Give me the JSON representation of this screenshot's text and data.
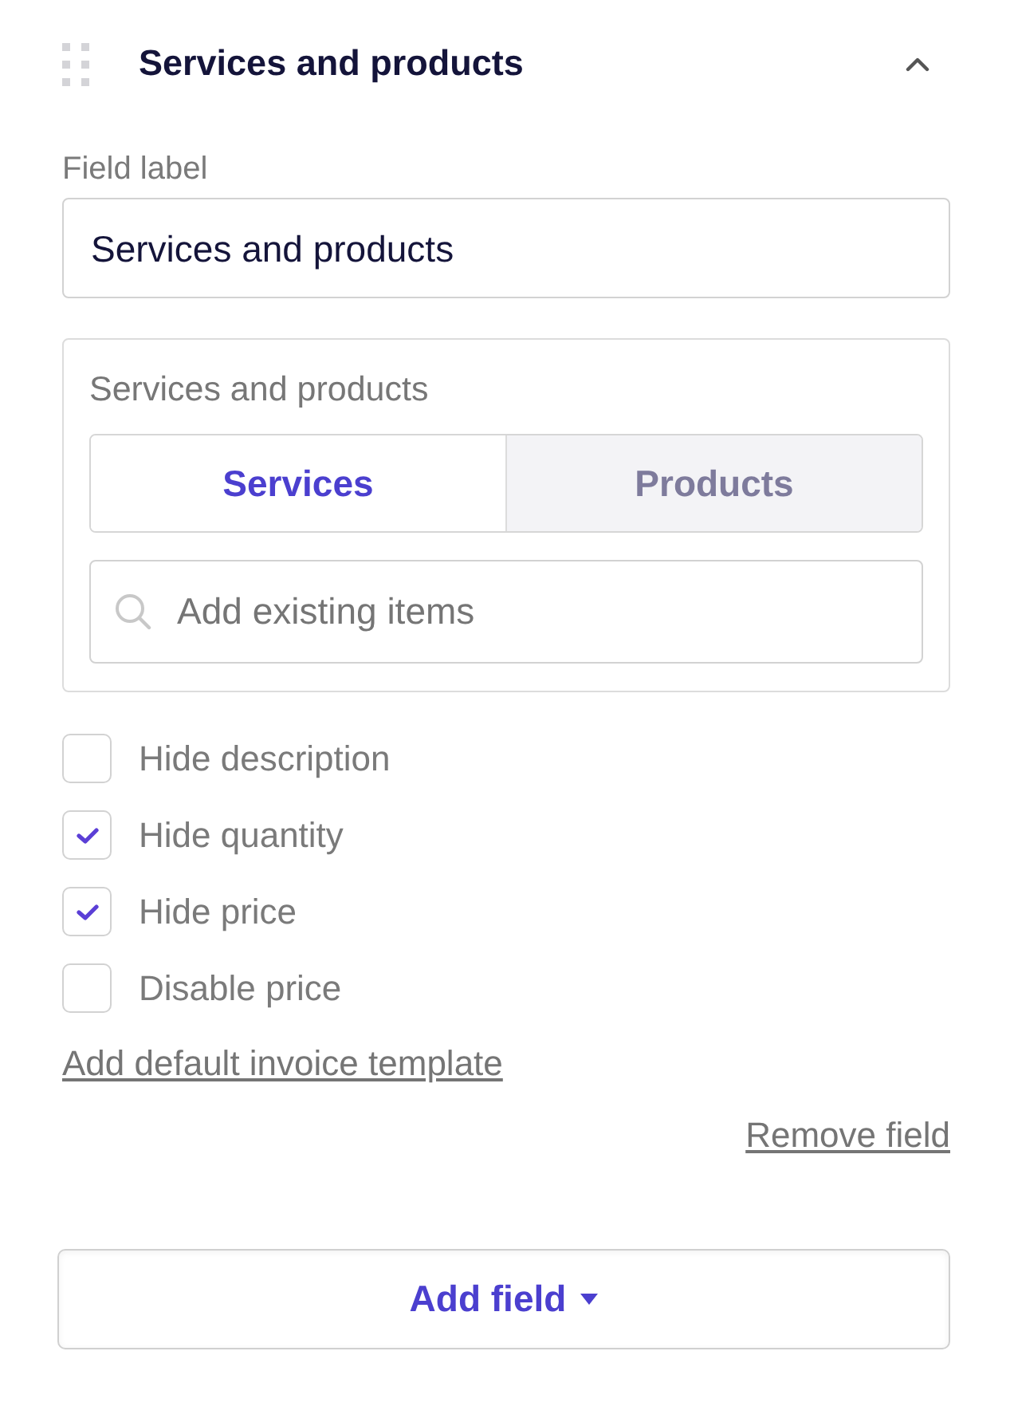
{
  "section": {
    "title": "Services and products",
    "expanded": true
  },
  "field_label": {
    "label": "Field label",
    "value": "Services and products"
  },
  "items_card": {
    "label": "Services and products",
    "tabs": [
      {
        "label": "Services",
        "selected": true
      },
      {
        "label": "Products",
        "selected": false
      }
    ],
    "search": {
      "placeholder": "Add existing items"
    }
  },
  "options": [
    {
      "label": "Hide description",
      "checked": false
    },
    {
      "label": "Hide quantity",
      "checked": true
    },
    {
      "label": "Hide price",
      "checked": true
    },
    {
      "label": "Disable price",
      "checked": false
    }
  ],
  "template_link": "Add default invoice template",
  "remove_link": "Remove field",
  "add_button": {
    "label": "Add field"
  }
}
